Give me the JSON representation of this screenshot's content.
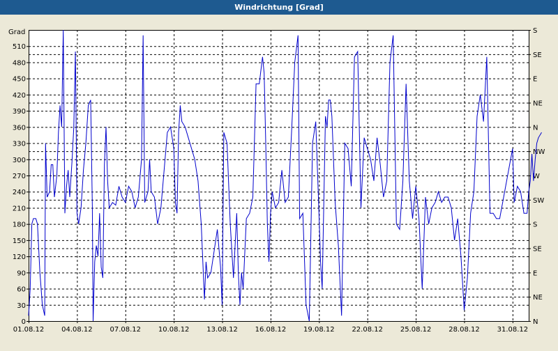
{
  "window": {
    "title": "Windrichtung [Grad]"
  },
  "chart_data": {
    "type": "line",
    "title": "Windrichtung [Grad]",
    "ylabel": "Grad",
    "ylim": [
      0,
      540
    ],
    "xlim": [
      0,
      31
    ],
    "left_ticks": [
      0,
      30,
      60,
      90,
      120,
      150,
      180,
      210,
      240,
      270,
      300,
      330,
      360,
      390,
      420,
      450,
      480,
      510
    ],
    "right_tick_labels": [
      {
        "value": 0,
        "label": "N"
      },
      {
        "value": 45,
        "label": "NE"
      },
      {
        "value": 90,
        "label": "E"
      },
      {
        "value": 135,
        "label": "SE"
      },
      {
        "value": 180,
        "label": "S"
      },
      {
        "value": 225,
        "label": "SW"
      },
      {
        "value": 270,
        "label": "W"
      },
      {
        "value": 315,
        "label": "NW"
      },
      {
        "value": 360,
        "label": "N"
      },
      {
        "value": 405,
        "label": "NE"
      },
      {
        "value": 450,
        "label": "E"
      },
      {
        "value": 495,
        "label": "SE"
      },
      {
        "value": 540,
        "label": "S"
      }
    ],
    "x_tick_labels": [
      {
        "day": 0,
        "label": "01.08.12"
      },
      {
        "day": 3,
        "label": "04.08.12"
      },
      {
        "day": 6,
        "label": "07.08.12"
      },
      {
        "day": 9,
        "label": "10.08.12"
      },
      {
        "day": 12,
        "label": "13.08.12"
      },
      {
        "day": 15,
        "label": "16.08.12"
      },
      {
        "day": 18,
        "label": "19.08.12"
      },
      {
        "day": 21,
        "label": "22.08.12"
      },
      {
        "day": 24,
        "label": "25.08.12"
      },
      {
        "day": 27,
        "label": "28.08.12"
      },
      {
        "day": 30,
        "label": "31.08.12"
      }
    ],
    "grid": true,
    "series": [
      {
        "color": "#0000CC",
        "points": [
          [
            0.0,
            10
          ],
          [
            0.1,
            60
          ],
          [
            0.2,
            180
          ],
          [
            0.3,
            190
          ],
          [
            0.45,
            190
          ],
          [
            0.55,
            180
          ],
          [
            0.7,
            90
          ],
          [
            0.85,
            30
          ],
          [
            1.0,
            10
          ],
          [
            1.05,
            330
          ],
          [
            1.15,
            230
          ],
          [
            1.3,
            240
          ],
          [
            1.4,
            290
          ],
          [
            1.5,
            290
          ],
          [
            1.6,
            230
          ],
          [
            1.75,
            270
          ],
          [
            1.85,
            350
          ],
          [
            1.95,
            400
          ],
          [
            2.05,
            360
          ],
          [
            2.15,
            540
          ],
          [
            2.25,
            200
          ],
          [
            2.35,
            250
          ],
          [
            2.45,
            280
          ],
          [
            2.55,
            230
          ],
          [
            2.7,
            300
          ],
          [
            2.8,
            360
          ],
          [
            2.9,
            500
          ],
          [
            3.0,
            200
          ],
          [
            3.1,
            180
          ],
          [
            3.25,
            210
          ],
          [
            3.4,
            280
          ],
          [
            3.55,
            330
          ],
          [
            3.7,
            400
          ],
          [
            3.85,
            410
          ],
          [
            3.95,
            210
          ],
          [
            4.0,
            0
          ],
          [
            4.1,
            110
          ],
          [
            4.2,
            140
          ],
          [
            4.3,
            120
          ],
          [
            4.4,
            200
          ],
          [
            4.5,
            100
          ],
          [
            4.6,
            80
          ],
          [
            4.7,
            290
          ],
          [
            4.8,
            360
          ],
          [
            4.9,
            260
          ],
          [
            5.0,
            210
          ],
          [
            5.2,
            220
          ],
          [
            5.4,
            215
          ],
          [
            5.6,
            250
          ],
          [
            5.8,
            230
          ],
          [
            6.0,
            220
          ],
          [
            6.2,
            250
          ],
          [
            6.4,
            240
          ],
          [
            6.6,
            210
          ],
          [
            6.8,
            230
          ],
          [
            7.0,
            300
          ],
          [
            7.1,
            530
          ],
          [
            7.2,
            220
          ],
          [
            7.4,
            240
          ],
          [
            7.5,
            300
          ],
          [
            7.6,
            240
          ],
          [
            7.8,
            230
          ],
          [
            8.0,
            180
          ],
          [
            8.2,
            210
          ],
          [
            8.4,
            280
          ],
          [
            8.6,
            350
          ],
          [
            8.8,
            360
          ],
          [
            9.0,
            320
          ],
          [
            9.1,
            220
          ],
          [
            9.2,
            200
          ],
          [
            9.3,
            350
          ],
          [
            9.4,
            400
          ],
          [
            9.5,
            370
          ],
          [
            9.7,
            360
          ],
          [
            9.9,
            340
          ],
          [
            10.1,
            320
          ],
          [
            10.3,
            300
          ],
          [
            10.5,
            260
          ],
          [
            10.7,
            180
          ],
          [
            10.9,
            40
          ],
          [
            11.0,
            110
          ],
          [
            11.1,
            80
          ],
          [
            11.3,
            90
          ],
          [
            11.5,
            130
          ],
          [
            11.7,
            170
          ],
          [
            11.9,
            100
          ],
          [
            12.0,
            30
          ],
          [
            12.1,
            350
          ],
          [
            12.3,
            330
          ],
          [
            12.5,
            180
          ],
          [
            12.7,
            80
          ],
          [
            12.9,
            200
          ],
          [
            13.0,
            90
          ],
          [
            13.1,
            30
          ],
          [
            13.2,
            90
          ],
          [
            13.3,
            60
          ],
          [
            13.5,
            190
          ],
          [
            13.7,
            200
          ],
          [
            13.9,
            230
          ],
          [
            14.1,
            440
          ],
          [
            14.3,
            440
          ],
          [
            14.5,
            490
          ],
          [
            14.6,
            460
          ],
          [
            14.7,
            330
          ],
          [
            14.8,
            180
          ],
          [
            14.9,
            110
          ],
          [
            15.0,
            200
          ],
          [
            15.1,
            240
          ],
          [
            15.3,
            210
          ],
          [
            15.5,
            220
          ],
          [
            15.7,
            280
          ],
          [
            15.9,
            220
          ],
          [
            16.1,
            230
          ],
          [
            16.3,
            350
          ],
          [
            16.5,
            480
          ],
          [
            16.7,
            530
          ],
          [
            16.8,
            190
          ],
          [
            17.0,
            200
          ],
          [
            17.2,
            30
          ],
          [
            17.4,
            0
          ],
          [
            17.6,
            330
          ],
          [
            17.8,
            370
          ],
          [
            18.0,
            200
          ],
          [
            18.1,
            110
          ],
          [
            18.2,
            60
          ],
          [
            18.4,
            380
          ],
          [
            18.5,
            360
          ],
          [
            18.6,
            410
          ],
          [
            18.7,
            410
          ],
          [
            18.8,
            380
          ],
          [
            19.0,
            220
          ],
          [
            19.2,
            140
          ],
          [
            19.4,
            10
          ],
          [
            19.6,
            330
          ],
          [
            19.8,
            320
          ],
          [
            20.0,
            250
          ],
          [
            20.2,
            490
          ],
          [
            20.4,
            500
          ],
          [
            20.6,
            210
          ],
          [
            20.8,
            340
          ],
          [
            21.0,
            320
          ],
          [
            21.2,
            300
          ],
          [
            21.4,
            260
          ],
          [
            21.6,
            340
          ],
          [
            21.8,
            290
          ],
          [
            22.0,
            230
          ],
          [
            22.2,
            260
          ],
          [
            22.4,
            480
          ],
          [
            22.6,
            530
          ],
          [
            22.8,
            180
          ],
          [
            23.0,
            170
          ],
          [
            23.2,
            260
          ],
          [
            23.4,
            440
          ],
          [
            23.6,
            260
          ],
          [
            23.8,
            190
          ],
          [
            24.0,
            250
          ],
          [
            24.2,
            190
          ],
          [
            24.4,
            60
          ],
          [
            24.6,
            230
          ],
          [
            24.8,
            180
          ],
          [
            25.0,
            210
          ],
          [
            25.2,
            220
          ],
          [
            25.4,
            240
          ],
          [
            25.6,
            220
          ],
          [
            25.8,
            230
          ],
          [
            26.0,
            230
          ],
          [
            26.2,
            210
          ],
          [
            26.4,
            150
          ],
          [
            26.6,
            190
          ],
          [
            26.8,
            120
          ],
          [
            27.0,
            20
          ],
          [
            27.2,
            80
          ],
          [
            27.4,
            200
          ],
          [
            27.6,
            240
          ],
          [
            27.8,
            380
          ],
          [
            28.0,
            420
          ],
          [
            28.2,
            370
          ],
          [
            28.4,
            490
          ],
          [
            28.6,
            200
          ],
          [
            28.8,
            200
          ],
          [
            29.0,
            190
          ],
          [
            29.2,
            190
          ],
          [
            30.0,
            320
          ],
          [
            30.1,
            220
          ],
          [
            30.3,
            250
          ],
          [
            30.5,
            240
          ],
          [
            30.7,
            200
          ],
          [
            30.9,
            200
          ],
          [
            31.0,
            240
          ],
          [
            31.1,
            260
          ],
          [
            31.2,
            310
          ],
          [
            31.3,
            260
          ],
          [
            31.4,
            300
          ],
          [
            31.5,
            330
          ],
          [
            31.6,
            340
          ],
          [
            31.8,
            350
          ]
        ]
      }
    ]
  }
}
